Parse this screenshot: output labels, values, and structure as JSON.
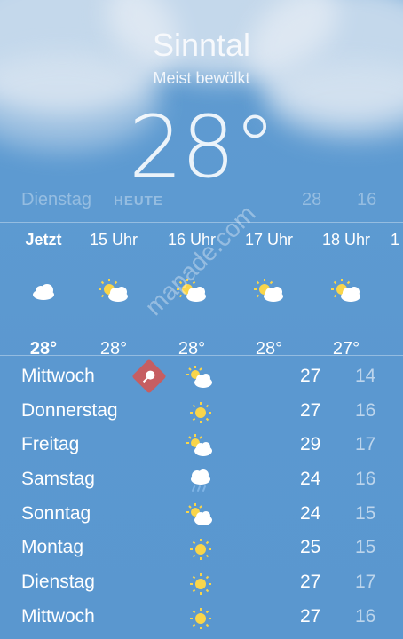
{
  "location": "Sinntal",
  "condition": "Meist bewölkt",
  "current_temp": "28°",
  "today": {
    "day": "Dienstag",
    "label": "HEUTE",
    "high": "28",
    "low": "16"
  },
  "hourly": [
    {
      "time": "Jetzt",
      "icon": "cloud-icon",
      "temp": "28°"
    },
    {
      "time": "15 Uhr",
      "icon": "partly-cloudy-icon",
      "temp": "28°"
    },
    {
      "time": "16 Uhr",
      "icon": "partly-cloudy-icon",
      "temp": "28°"
    },
    {
      "time": "17 Uhr",
      "icon": "partly-cloudy-icon",
      "temp": "28°"
    },
    {
      "time": "18 Uhr",
      "icon": "partly-cloudy-icon",
      "temp": "27°"
    },
    {
      "time": "1",
      "icon": "",
      "temp": ""
    }
  ],
  "daily": [
    {
      "day": "Mittwoch",
      "icon": "partly-cloudy-icon",
      "high": "27",
      "low": "14"
    },
    {
      "day": "Donnerstag",
      "icon": "sun-icon",
      "high": "27",
      "low": "16"
    },
    {
      "day": "Freitag",
      "icon": "partly-cloudy-icon",
      "high": "29",
      "low": "17"
    },
    {
      "day": "Samstag",
      "icon": "rain-icon",
      "high": "24",
      "low": "16"
    },
    {
      "day": "Sonntag",
      "icon": "partly-cloudy-icon",
      "high": "24",
      "low": "15"
    },
    {
      "day": "Montag",
      "icon": "sun-icon",
      "high": "25",
      "low": "15"
    },
    {
      "day": "Dienstag",
      "icon": "sun-icon",
      "high": "27",
      "low": "17"
    },
    {
      "day": "Mittwoch",
      "icon": "sun-icon",
      "high": "27",
      "low": "16"
    }
  ],
  "watermark": "mapade.com",
  "colors": {
    "sky": "#5b98d0",
    "sun": "#f9d54a",
    "watermark_pin": "#d9534f"
  }
}
